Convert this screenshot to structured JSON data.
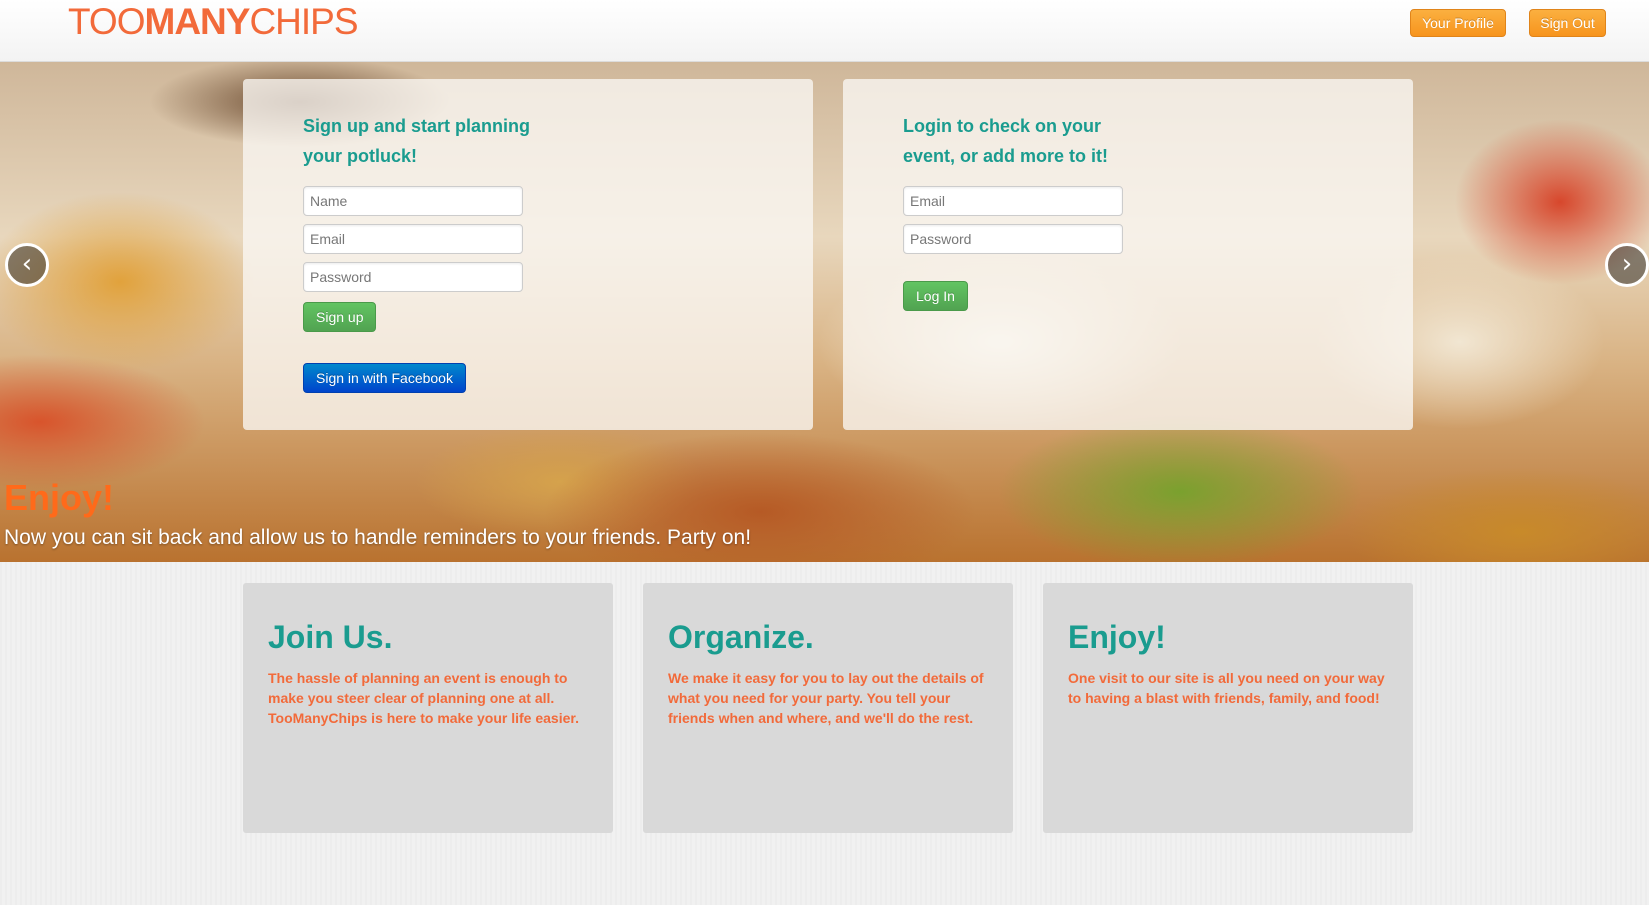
{
  "header": {
    "logo_part1": "TOO",
    "logo_part2": "MANY",
    "logo_part3": "CHIPS",
    "profile_label": "Your Profile",
    "signout_label": "Sign Out"
  },
  "signup": {
    "heading": "Sign up and start planning your potluck!",
    "name_placeholder": "Name",
    "email_placeholder": "Email",
    "password_placeholder": "Password",
    "signup_label": "Sign up",
    "facebook_label": "Sign in with Facebook"
  },
  "login": {
    "heading": "Login to check on your event, or add more to it!",
    "email_placeholder": "Email",
    "password_placeholder": "Password",
    "login_label": "Log In"
  },
  "carousel": {
    "prev_icon": "‹",
    "next_icon": "›",
    "caption_title": "Enjoy!",
    "caption_text": "Now you can sit back and allow us to handle reminders to your friends. Party on!"
  },
  "features": [
    {
      "title": "Join Us.",
      "text": "The hassle of planning an event is enough to make you steer clear of planning one at all. TooManyChips is here to make your life easier."
    },
    {
      "title": "Organize.",
      "text": "We make it easy for you to lay out the details of what you need for your party. You tell your friends when and where, and we'll do the rest."
    },
    {
      "title": "Enjoy!",
      "text": "One visit to our site is all you need on your way to having a blast with friends, family, and food!"
    }
  ],
  "colors": {
    "brand_orange": "#f26a3a",
    "teal": "#1a9c8f",
    "button_orange": "#f7941d",
    "button_green": "#51a351",
    "button_blue": "#0044cc"
  }
}
